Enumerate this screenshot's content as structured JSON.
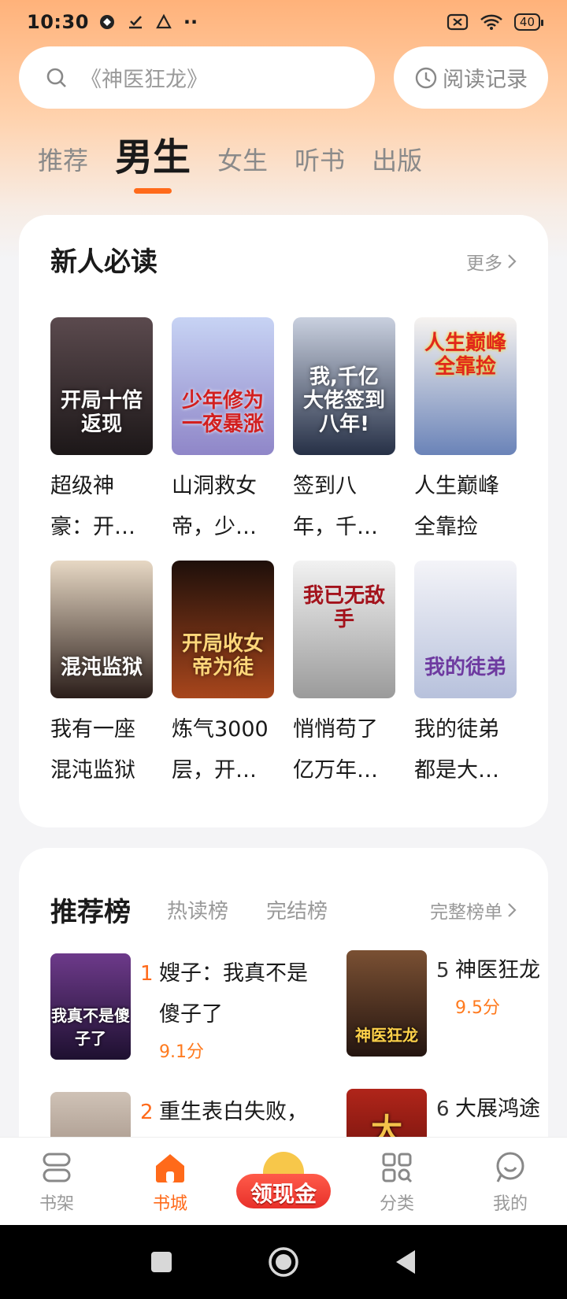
{
  "status_bar": {
    "time": "10:30",
    "battery": "40"
  },
  "search": {
    "placeholder": "《神医狂龙》",
    "history_label": "阅读记录"
  },
  "tabs": [
    {
      "label": "推荐"
    },
    {
      "label": "男生",
      "active": true
    },
    {
      "label": "女生"
    },
    {
      "label": "听书"
    },
    {
      "label": "出版"
    }
  ],
  "new_reader": {
    "title": "新人必读",
    "more_label": "更多",
    "books": [
      {
        "title": "超级神豪：开…",
        "cover_text": "开局十倍返现",
        "cover_color": "#2a2326"
      },
      {
        "title": "山洞救女帝，少…",
        "cover_text": "少年修为一夜暴涨",
        "cover_color": "#b9c8ee"
      },
      {
        "title": "签到八年，千…",
        "cover_text": "我,千亿大佬签到八年!",
        "cover_color": "#3c4a66"
      },
      {
        "title": "人生巅峰全靠捡",
        "cover_text": "人生巅峰全靠捡",
        "cover_color": "#dfe6f2"
      },
      {
        "title": "我有一座混沌监狱",
        "cover_text": "混沌监狱",
        "cover_color": "#3b2e2a"
      },
      {
        "title": "炼气3000层，开…",
        "cover_text": "开局收女帝为徒",
        "cover_color": "#5a2a18"
      },
      {
        "title": "悄悄苟了亿万年…",
        "cover_text": "我已无敌手",
        "cover_color": "#d8d8d8"
      },
      {
        "title": "我的徒弟都是大…",
        "cover_text": "我的徒弟",
        "cover_color": "#d2d8e6"
      }
    ]
  },
  "ranking": {
    "title": "推荐榜",
    "tabs": [
      "热读榜",
      "完结榜"
    ],
    "full_list_label": "完整榜单",
    "items": [
      {
        "rank": "1",
        "name": "嫂子：我真不是傻子了",
        "score": "9.1分",
        "cover_text": "我真不是傻子了",
        "cover_color": "#3b1f4a"
      },
      {
        "rank": "5",
        "name": "神医狂龙",
        "score": "9.5分",
        "cover_text": "神医狂龙",
        "cover_color": "#3a2618"
      },
      {
        "rank": "2",
        "name": "重生表白失败，",
        "score": "",
        "cover_text": "",
        "cover_color": "#b8a89c"
      },
      {
        "rank": "6",
        "name": "大展鸿途",
        "score": "",
        "cover_text": "大",
        "cover_color": "#8f1a12"
      }
    ]
  },
  "bottom_nav": [
    {
      "label": "书架",
      "icon": "bookshelf-icon"
    },
    {
      "label": "书城",
      "icon": "bookstore-icon",
      "active": true
    },
    {
      "label": "领现金",
      "icon": "cash-icon"
    },
    {
      "label": "分类",
      "icon": "category-icon"
    },
    {
      "label": "我的",
      "icon": "profile-icon"
    }
  ]
}
